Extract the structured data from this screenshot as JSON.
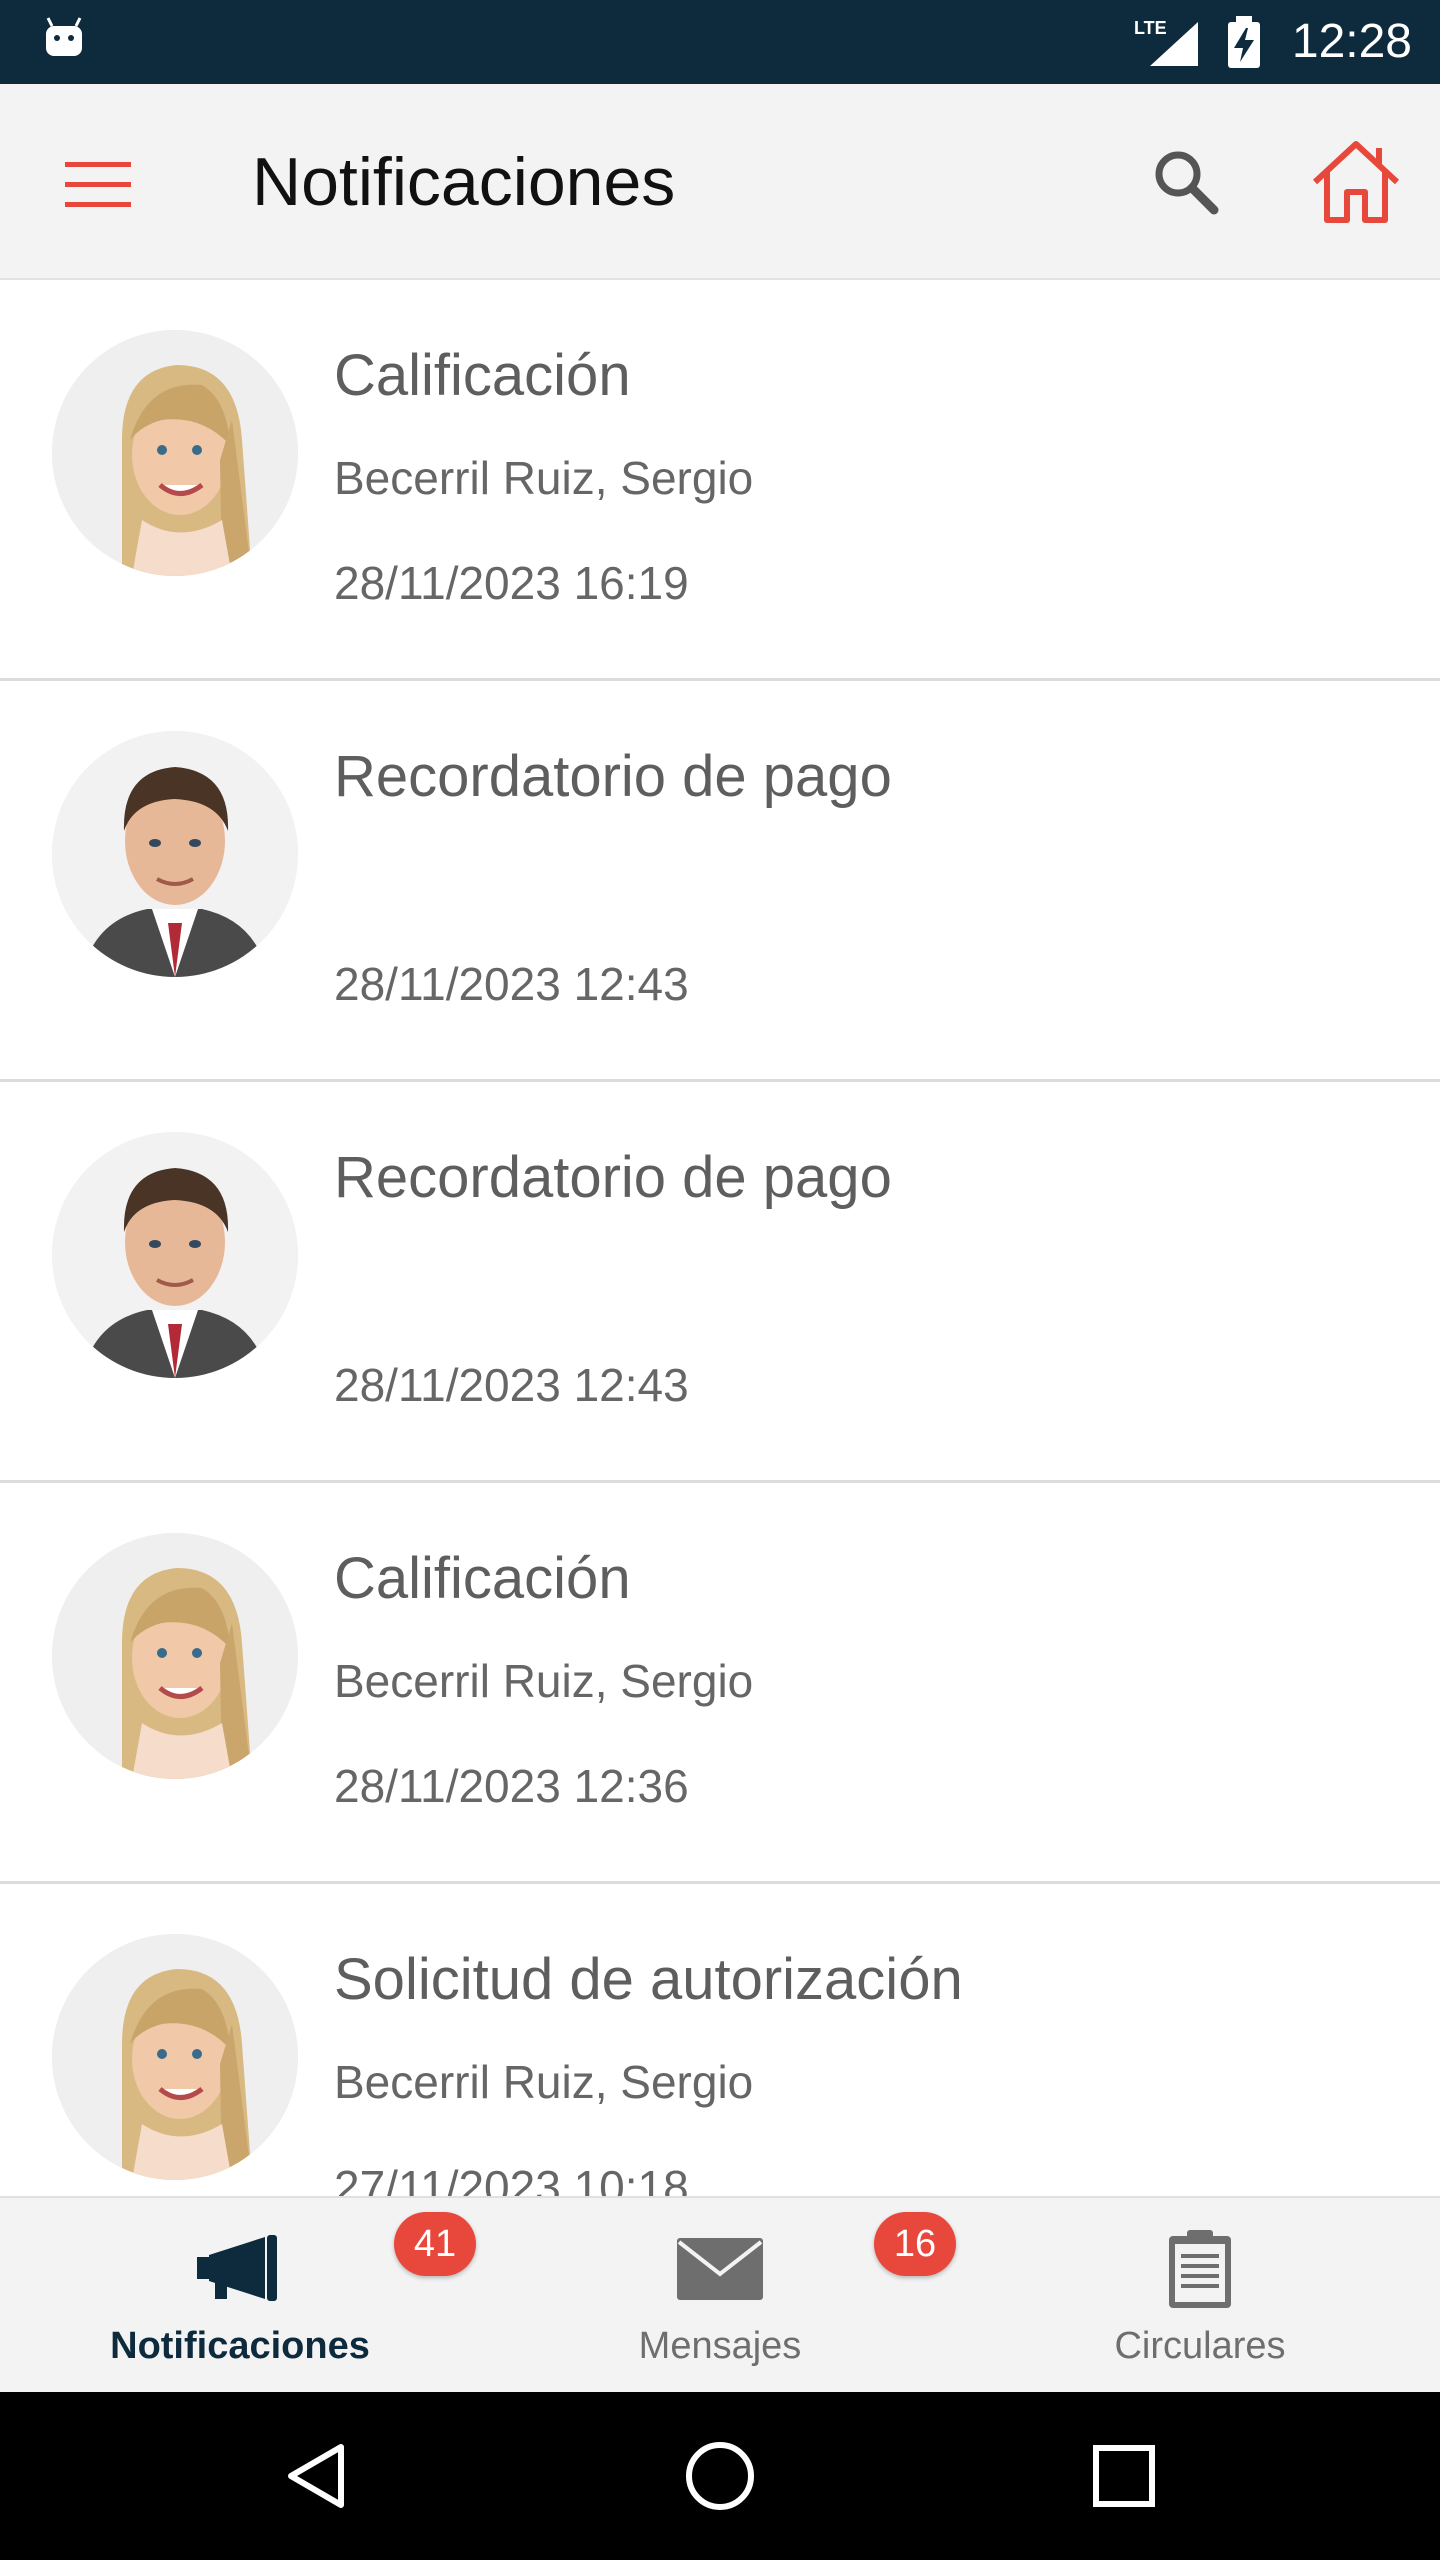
{
  "status_bar": {
    "time": "12:28",
    "network": "LTE",
    "left_icon": "android-debug-icon"
  },
  "app_bar": {
    "title": "Notificaciones",
    "menu_icon": "hamburger-menu-icon",
    "search_icon": "search-icon",
    "home_icon": "home-icon",
    "accent_color": "#e8473b"
  },
  "notifications": [
    {
      "title": "Calificación",
      "sender": "Becerril Ruiz, Sergio",
      "date": "28/11/2023 16:19",
      "avatar": "girl-avatar"
    },
    {
      "title": "Recordatorio de pago",
      "sender": "",
      "date": "28/11/2023 12:43",
      "avatar": "man-avatar"
    },
    {
      "title": "Recordatorio de pago",
      "sender": "",
      "date": "28/11/2023 12:43",
      "avatar": "man-avatar"
    },
    {
      "title": "Calificación",
      "sender": "Becerril Ruiz, Sergio",
      "date": "28/11/2023 12:36",
      "avatar": "girl-avatar"
    },
    {
      "title": "Solicitud de autorización",
      "sender": "Becerril Ruiz, Sergio",
      "date": "27/11/2023 10:18",
      "avatar": "girl-avatar"
    }
  ],
  "tabs": [
    {
      "label": "Notificaciones",
      "icon": "megaphone-icon",
      "badge": "41",
      "active": true
    },
    {
      "label": "Mensajes",
      "icon": "envelope-icon",
      "badge": "16",
      "active": false
    },
    {
      "label": "Circulares",
      "icon": "clipboard-icon",
      "badge": "",
      "active": false
    }
  ],
  "colors": {
    "status_bar": "#0e2a3d",
    "badge": "#e8473b",
    "active_tab": "#0e2a3d"
  }
}
